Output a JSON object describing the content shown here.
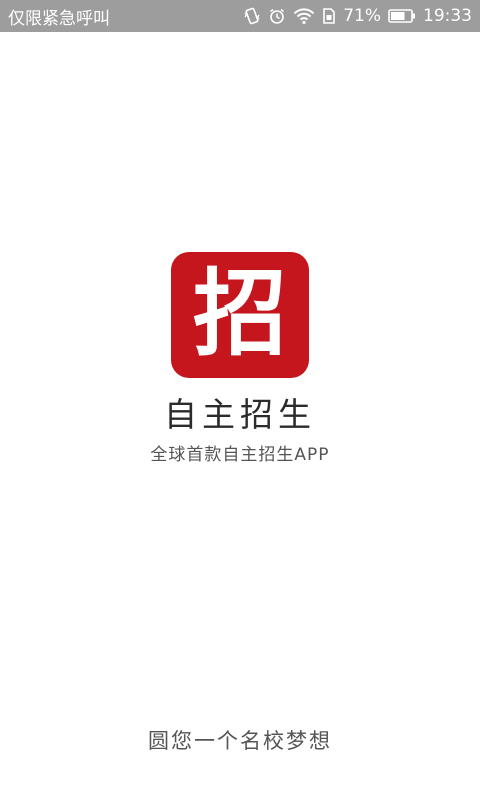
{
  "status_bar": {
    "carrier_text": "仅限紧急呼叫",
    "battery_percent_text": "71%",
    "time": "19:33",
    "battery_level": 71,
    "icons": [
      "vibrate-icon",
      "alarm-icon",
      "wifi-icon",
      "sim-icon",
      "battery-icon"
    ],
    "background_color": "#9d9d9d"
  },
  "splash": {
    "logo": {
      "glyph": "招",
      "color": "#c4161c"
    },
    "app_name": "自主招生",
    "tagline": "全球首款自主招生APP",
    "slogan": "圆您一个名校梦想"
  }
}
